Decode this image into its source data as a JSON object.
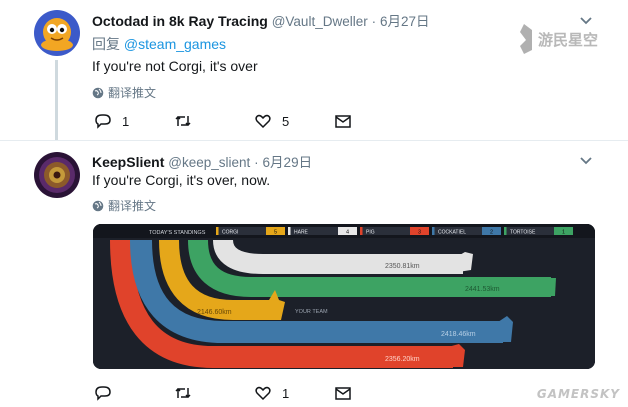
{
  "tweets": [
    {
      "display_name": "Octodad in 8k Ray Tracing",
      "handle": "@Vault_Dweller",
      "separator": "·",
      "date": "6月27日",
      "reply_prefix": "回复",
      "reply_to": "@steam_games",
      "text": "If you're not Corgi, it's over",
      "translate_label": "翻译推文",
      "reply_count": "1",
      "retweet_count": "",
      "like_count": "5"
    },
    {
      "display_name": "KeepSlient",
      "handle": "@keep_slient",
      "separator": "·",
      "date": "6月29日",
      "text": "If you're Corgi, it's over, now.",
      "translate_label": "翻译推文",
      "reply_count": "",
      "retweet_count": "",
      "like_count": "1"
    }
  ],
  "media": {
    "standings_title": "TODAY'S STANDINGS",
    "standings": [
      {
        "name": "CORGI",
        "value": "5",
        "color": "#e5a71a"
      },
      {
        "name": "HARE",
        "value": "4",
        "color": "#e8e8e8"
      },
      {
        "name": "PIG",
        "value": "3",
        "color": "#e0432b"
      },
      {
        "name": "COCKATIEL",
        "value": "2",
        "color": "#3f78a8"
      },
      {
        "name": "TORTOISE",
        "value": "1",
        "color": "#3da363"
      }
    ],
    "tracks": [
      {
        "team": "hare",
        "distance": "2350.81km",
        "color": "#e3e3e3"
      },
      {
        "team": "tortoise",
        "distance": "2441.53km",
        "color": "#3da363"
      },
      {
        "team": "corgi",
        "distance": "2146.60km",
        "color": "#e5a71a"
      },
      {
        "team": "cockatiel",
        "distance": "2418.46km",
        "color": "#3f78a8"
      },
      {
        "team": "pig",
        "distance": "2356.20km",
        "color": "#e0432b"
      }
    ],
    "your_team_label": "YOUR TEAM"
  },
  "watermark": {
    "top_text": "游民星空",
    "bottom_text": "GAMERSKY"
  },
  "colors": {
    "link": "#1b95e0",
    "meta": "#657786",
    "text": "#14171a"
  }
}
